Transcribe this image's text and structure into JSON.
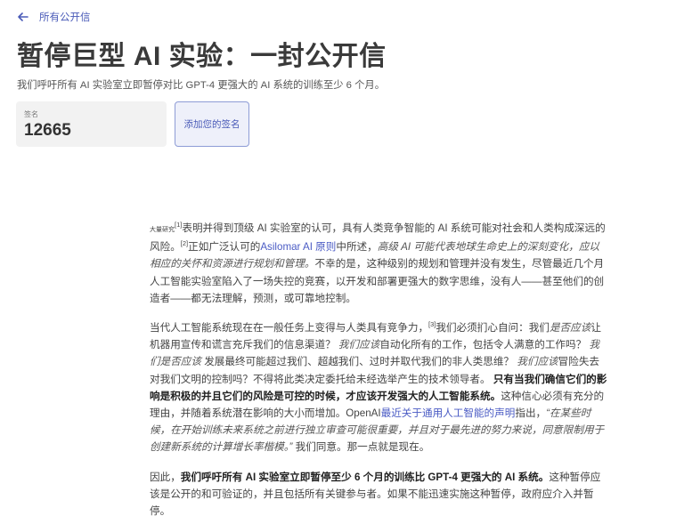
{
  "nav": {
    "back_label": "所有公开信"
  },
  "header": {
    "title": "暂停巨型 AI 实验：一封公开信",
    "subtitle": "我们呼吁所有 AI 实验室立即暂停对比 GPT-4 更强大的 AI 系统的训练至少 6 个月。"
  },
  "signatures": {
    "label": "签名",
    "count": "12665",
    "add_button": "添加您的签名"
  },
  "colors": {
    "accent": "#4a5bb8",
    "text": "#333333",
    "panel": "#f2f2f2"
  },
  "paragraphs": [
    [
      {
        "s": "small",
        "t": "大量研究"
      },
      {
        "s": "sup",
        "t": "[1]"
      },
      {
        "s": "n",
        "t": "表明并得到顶级 AI 实验室的认可，具有人类竞争智能的 AI 系统可能对社会和人类构成深远的风险。"
      },
      {
        "s": "sup",
        "t": "[2]"
      },
      {
        "s": "n",
        "t": "正如广泛认可的"
      },
      {
        "s": "a",
        "t": "Asilomar AI 原则"
      },
      {
        "s": "n",
        "t": "中所述，"
      },
      {
        "s": "i",
        "t": "高级 AI 可能代表地球生命史上的深刻变化，应以相应的关怀和资源进行规划和管理。"
      },
      {
        "s": "n",
        "t": "不幸的是，这种级别的规划和管理并没有发生，尽管最近几个月人工智能实验室陷入了一场失控的竞赛，以开发和部署更强大的数字思维，没有人——甚至他们的创造者——都无法理解，预测，或可靠地控制。"
      }
    ],
    [
      {
        "s": "n",
        "t": "当代人工智能系统现在在一般任务上变得与人类具有竞争力，"
      },
      {
        "s": "sup",
        "t": "[3]"
      },
      {
        "s": "n",
        "t": "我们必须扪心自问：我们"
      },
      {
        "s": "i",
        "t": "是否应该"
      },
      {
        "s": "n",
        "t": "让机器用宣传和谎言充斥我们的信息渠道？ "
      },
      {
        "s": "i",
        "t": "我们应该"
      },
      {
        "s": "n",
        "t": "自动化所有的工作，包括令人满意的工作吗？ "
      },
      {
        "s": "i",
        "t": "我们是否应该"
      },
      {
        "s": "n",
        "t": " 发展最终可能超过我们、超越我们、过时并取代我们的非人类思维？ "
      },
      {
        "s": "i",
        "t": "我们应该"
      },
      {
        "s": "n",
        "t": "冒险失去对我们文明的控制吗？不得将此类决定委托给未经选举产生的技术领导者。 "
      },
      {
        "s": "b",
        "t": "只有当我们确信它们的影响是积极的并且它们的风险是可控的时候，才应该开发强大的人工智能系统。"
      },
      {
        "s": "n",
        "t": "这种信心必须有充分的理由，并随着系统潜在影响的大小而增加。OpenAI"
      },
      {
        "s": "a",
        "t": "最近关于通用人工智能的声明"
      },
      {
        "s": "n",
        "t": "指出，"
      },
      {
        "s": "i",
        "t": "“在某些时候，在开始训练未来系统之前进行独立审查可能很重要，并且对于最先进的努力来说，同意限制用于创建新系统的计算增长率楷模。”"
      },
      {
        "s": "n",
        "t": " 我们同意。那一点就是现在。"
      }
    ],
    [
      {
        "s": "n",
        "t": "因此，"
      },
      {
        "s": "b",
        "t": "我们呼吁所有 AI 实验室立即暂停至少 6 个月的训练比 GPT-4 更强大的 AI 系统。"
      },
      {
        "s": "n",
        "t": "这种暂停应该是公开的和可验证的，并且包括所有关键参与者。如果不能迅速实施这种暂停，政府应介入并暂停。"
      }
    ]
  ]
}
